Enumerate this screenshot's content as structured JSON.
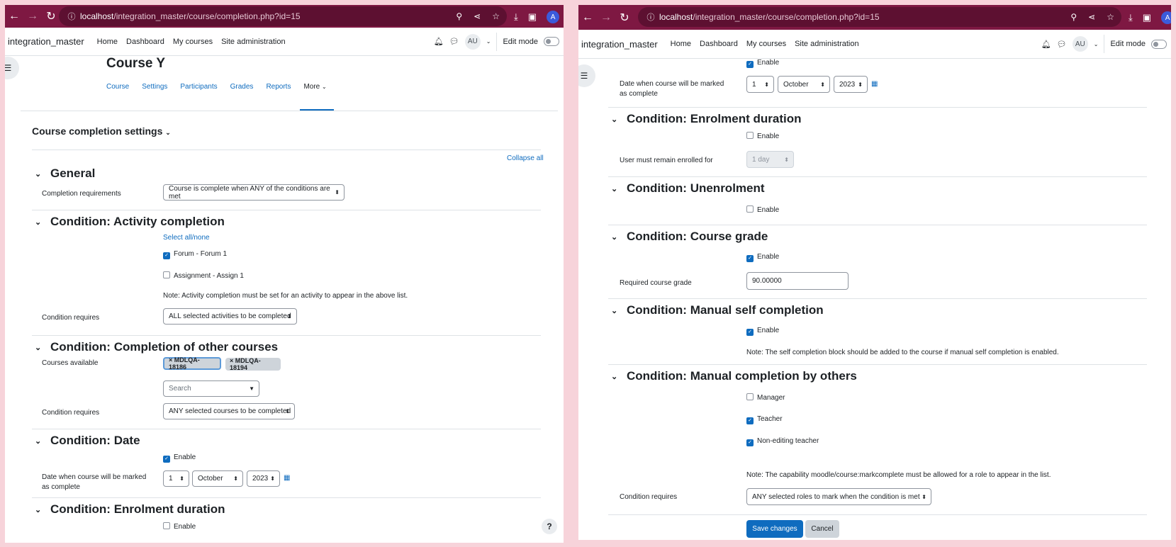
{
  "browser": {
    "url_host": "localhost",
    "url_path": "/integration_master/course/completion.php?id=15",
    "profile_initial": "A"
  },
  "navbar": {
    "site_name": "integration_master",
    "links": [
      "Home",
      "Dashboard",
      "My courses",
      "Site administration"
    ],
    "avatar": "AU",
    "edit_mode": "Edit mode"
  },
  "left": {
    "course_title": "Course Y",
    "tabs": [
      "Course",
      "Settings",
      "Participants",
      "Grades",
      "Reports",
      "More"
    ],
    "page_heading": "Course completion settings",
    "collapse_all": "Collapse all",
    "general": {
      "heading": "General",
      "completion_requirements_label": "Completion requirements",
      "completion_requirements_value": "Course is complete when ANY of the conditions are met"
    },
    "activity": {
      "heading": "Condition: Activity completion",
      "select_all": "Select all/none",
      "item1": "Forum - Forum 1",
      "item2": "Assignment - Assign 1",
      "note": "Note: Activity completion must be set for an activity to appear in the above list.",
      "requires_label": "Condition requires",
      "requires_value": "ALL selected activities to be completed"
    },
    "other_courses": {
      "heading": "Condition: Completion of other courses",
      "available_label": "Courses available",
      "tag1": "× MDLQA-18186",
      "tag2": "× MDLQA-18194",
      "search_placeholder": "Search",
      "requires_label": "Condition requires",
      "requires_value": "ANY selected courses to be completed"
    },
    "date": {
      "heading": "Condition: Date",
      "enable": "Enable",
      "label": "Date when course will be marked as complete",
      "day": "1",
      "month": "October",
      "year": "2023"
    },
    "enrolment": {
      "heading": "Condition: Enrolment duration",
      "enable": "Enable"
    },
    "help": "?"
  },
  "right": {
    "top_enable": "Enable",
    "date": {
      "label": "Date when course will be marked as complete",
      "day": "1",
      "month": "October",
      "year": "2023"
    },
    "enrolment": {
      "heading": "Condition: Enrolment duration",
      "enable": "Enable",
      "remain_label": "User must remain enrolled for",
      "remain_value": "1 day"
    },
    "unenrolment": {
      "heading": "Condition: Unenrolment",
      "enable": "Enable"
    },
    "grade": {
      "heading": "Condition: Course grade",
      "enable": "Enable",
      "label": "Required course grade",
      "value": "90.00000"
    },
    "self": {
      "heading": "Condition: Manual self completion",
      "enable": "Enable",
      "note": "Note: The self completion block should be added to the course if manual self completion is enabled."
    },
    "others": {
      "heading": "Condition: Manual completion by others",
      "role1": "Manager",
      "role2": "Teacher",
      "role3": "Non-editing teacher",
      "note": "Note: The capability moodle/course:markcomplete must be allowed for a role to appear in the list.",
      "requires_label": "Condition requires",
      "requires_value": "ANY selected roles to mark when the condition is met"
    },
    "save": "Save changes",
    "cancel": "Cancel"
  }
}
